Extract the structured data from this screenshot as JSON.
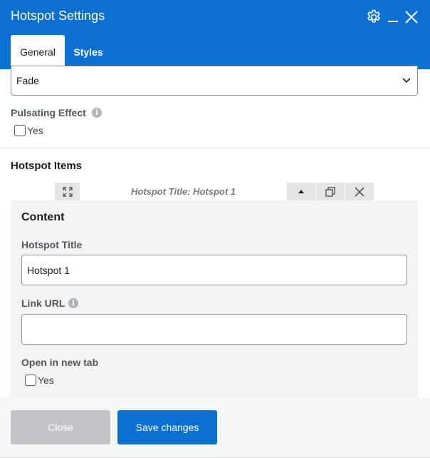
{
  "dialog": {
    "title": "Hotspot Settings"
  },
  "tabs": [
    {
      "label": "General",
      "active": true
    },
    {
      "label": "Styles",
      "active": false
    }
  ],
  "animation_select": {
    "value": "Fade"
  },
  "pulsating": {
    "label": "Pulsating Effect",
    "checkbox_label": "Yes",
    "checked": false
  },
  "hotspot_items": {
    "heading": "Hotspot Items",
    "item_header": "Hotspot Title: Hotspot 1",
    "content_heading": "Content",
    "title_label": "Hotspot Title",
    "title_value": "Hotspot 1",
    "link_label": "Link URL",
    "link_value": "",
    "new_tab_label": "Open in new tab",
    "new_tab_checkbox_label": "Yes",
    "new_tab_checked": false
  },
  "footer": {
    "close_label": "Close",
    "save_label": "Save changes"
  },
  "colors": {
    "primary": "#0c70d2",
    "disabled": "#c3c4c7",
    "panel": "#f4f4f4"
  },
  "icons": [
    "gear-icon",
    "minimize-icon",
    "close-icon",
    "chevron-down-icon",
    "info-icon",
    "expand-icon",
    "arrow-up-icon",
    "duplicate-icon",
    "remove-icon"
  ]
}
